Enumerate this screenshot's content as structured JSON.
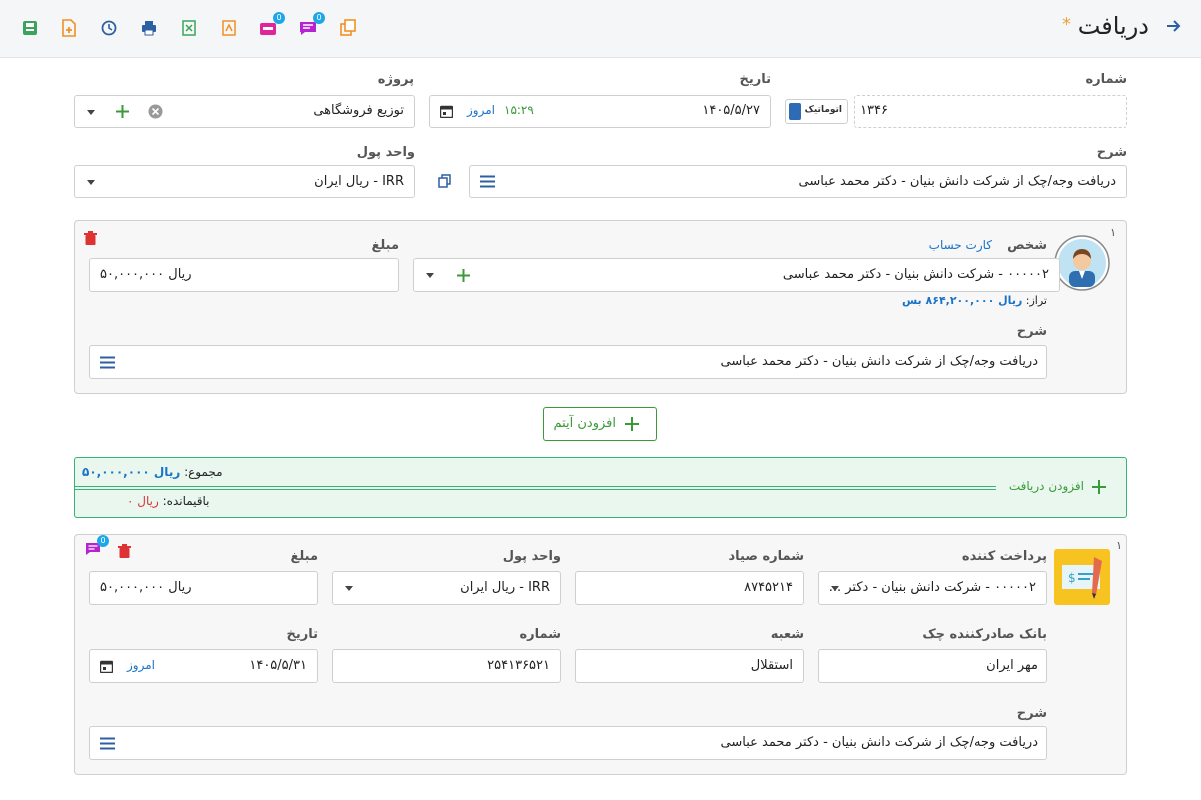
{
  "header": {
    "title": "دریافت",
    "star": "*",
    "toolbar_badges": {
      "notifications": "0",
      "comments": "0"
    }
  },
  "form": {
    "number_label": "شماره",
    "number_value": "۱۳۴۶",
    "auto_label": "اتوماتیک",
    "date_label": "تاریخ",
    "date_value": "۱۴۰۵/۵/۲۷",
    "time_value": "۱۵:۲۹",
    "today_label": "امروز",
    "project_label": "پروژه",
    "project_value": "توزیع فروشگاهی",
    "desc_label": "شرح",
    "desc_value": "دریافت وجه/چک از شرکت دانش بنیان - دکتر محمد عباسی",
    "currency_label": "واحد پول",
    "currency_value": "IRR - ریال ایران"
  },
  "item": {
    "index": "۱",
    "person_label": "شخص",
    "account_card_link": "کارت حساب",
    "person_value": "۰۰۰۰۰۲ - شرکت دانش بنیان - دکتر محمد عباسی",
    "balance_label": "تراز:",
    "balance_value": "ریال ۸۶۴,۲۰۰,۰۰۰ بس",
    "amount_label": "مبلغ",
    "amount_value": "ریال ۵۰,۰۰۰,۰۰۰",
    "desc_label": "شرح",
    "desc_value": "دریافت وجه/چک از شرکت دانش بنیان - دکتر محمد عباسی"
  },
  "add_item_button": "افزودن آیتم",
  "summary": {
    "add_receipt": "افزودن دریافت",
    "total_label": "مجموع:",
    "total_value": "ریال ۵۰,۰۰۰,۰۰۰",
    "remaining_label": "باقیمانده:",
    "remaining_value": "ریال ۰"
  },
  "receipt": {
    "index": "۱",
    "badge": "0",
    "payer_label": "پرداخت کننده",
    "payer_value": "۰۰۰۰۰۲ - شرکت دانش بنیان - دکتر ...",
    "sayad_label": "شماره صیاد",
    "sayad_value": "۸۷۴۵۲۱۴",
    "currency_label": "واحد پول",
    "currency_value": "IRR - ریال ایران",
    "amount_label": "مبلغ",
    "amount_value": "ریال ۵۰,۰۰۰,۰۰۰",
    "bank_label": "بانک صادرکننده چک",
    "bank_value": "مهر ایران",
    "branch_label": "شعبه",
    "branch_value": "استقلال",
    "number_label": "شماره",
    "number_value": "۲۵۴۱۳۶۵۲۱",
    "date_label": "تاریخ",
    "date_value": "۱۴۰۵/۵/۳۱",
    "today_label": "امروز",
    "desc_label": "شرح",
    "desc_value": "دریافت وجه/چک از شرکت دانش بنیان - دکتر محمد عباسی"
  }
}
